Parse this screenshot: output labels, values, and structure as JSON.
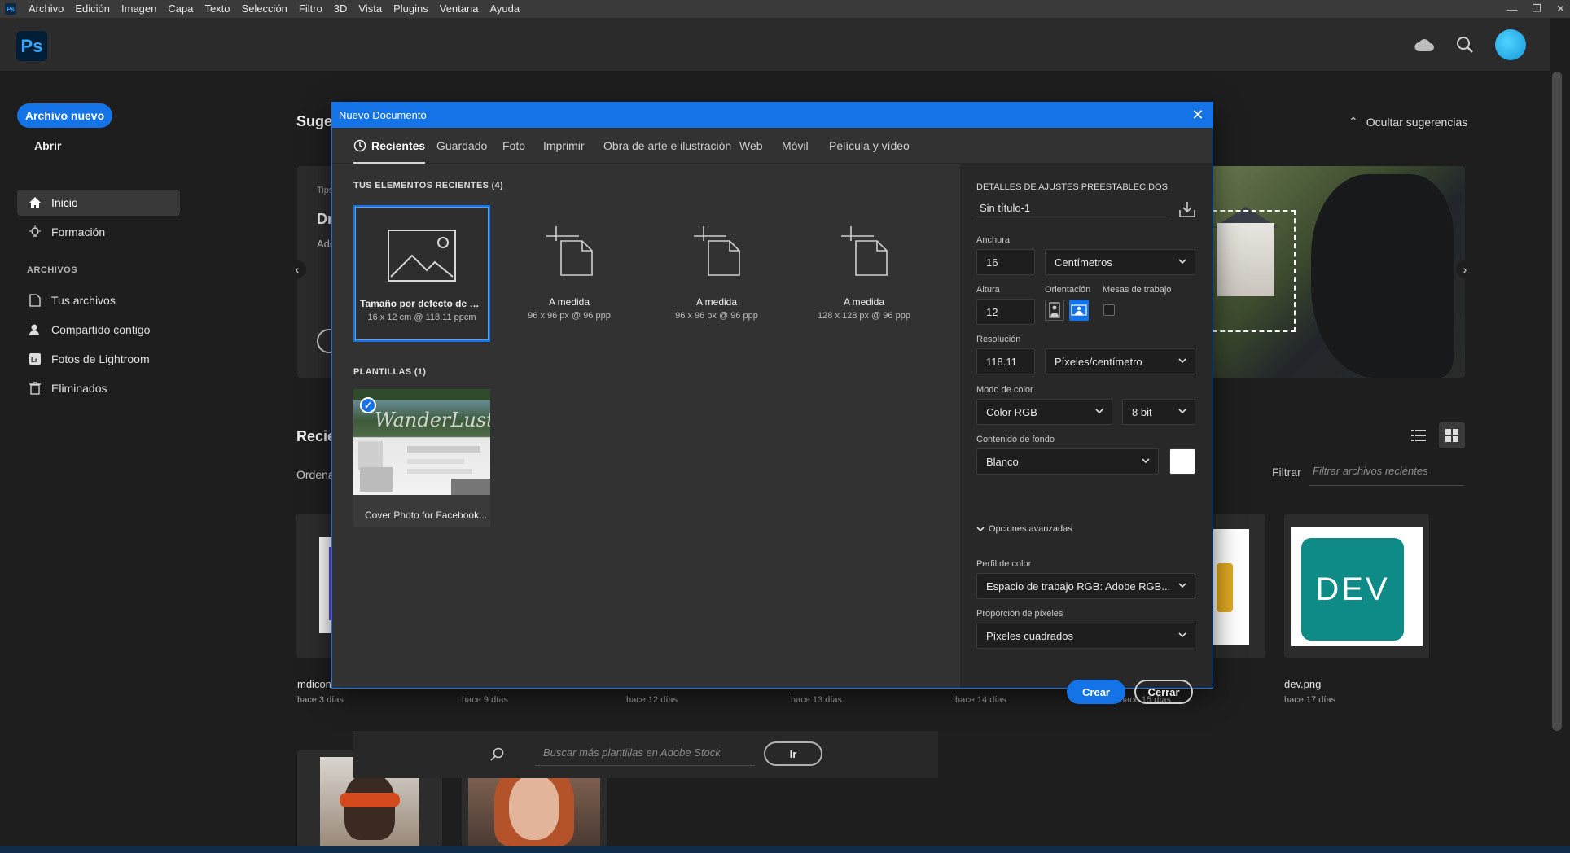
{
  "menubar": {
    "app_icon": "Ps",
    "items": [
      "Archivo",
      "Edición",
      "Imagen",
      "Capa",
      "Texto",
      "Selección",
      "Filtro",
      "3D",
      "Vista",
      "Plugins",
      "Ventana",
      "Ayuda"
    ]
  },
  "header": {
    "logo": "Ps",
    "icons": [
      "cloud-icon",
      "search-icon",
      "avatar"
    ]
  },
  "sidebar": {
    "new_file": "Archivo nuevo",
    "open": "Abrir",
    "nav": [
      {
        "label": "Inicio",
        "icon": "home-icon",
        "active": true
      },
      {
        "label": "Formación",
        "icon": "lightbulb-icon",
        "active": false
      }
    ],
    "files_section": "ARCHIVOS",
    "files": [
      {
        "label": "Tus archivos",
        "icon": "file-icon"
      },
      {
        "label": "Compartido contigo",
        "icon": "shared-user-icon"
      },
      {
        "label": "Fotos de Lightroom",
        "icon": "lightroom-icon"
      },
      {
        "label": "Eliminados",
        "icon": "trash-icon"
      }
    ]
  },
  "home": {
    "suggestions_title_partial": "Suger",
    "hide_suggestions": "Ocultar sugerencias",
    "banner_partial": {
      "tips": "Tips",
      "heading": "Dr",
      "sub": "Adc"
    },
    "recent_title_partial": "Recie",
    "sort_partial": "Ordena",
    "filter_label": "Filtrar",
    "filter_placeholder": "Filtrar archivos recientes",
    "files": [
      {
        "name": "mdicon",
        "date": "hace 3 días"
      },
      {
        "name": "",
        "date": "hace 9 días"
      },
      {
        "name": "",
        "date": "hace 12 días"
      },
      {
        "name": "",
        "date": "hace 13 días"
      },
      {
        "name": "",
        "date": "hace 14 días"
      },
      {
        "name": "",
        "date": "hace 15 días"
      },
      {
        "name": "dev.png",
        "date": "hace 17 días",
        "thumb_text": "DEV"
      }
    ]
  },
  "dialog": {
    "title": "Nuevo Documento",
    "tabs": [
      "Recientes",
      "Guardado",
      "Foto",
      "Imprimir",
      "Obra de arte e ilustración",
      "Web",
      "Móvil",
      "Película y vídeo"
    ],
    "active_tab": "Recientes",
    "recent_heading": "TUS ELEMENTOS RECIENTES",
    "recent_count": "(4)",
    "presets": [
      {
        "name": "Tamaño por defecto de Ph...",
        "dims": "16 x 12 cm @ 118.11 ppcm",
        "selected": true
      },
      {
        "name": "A medida",
        "dims": "96 x 96 px @ 96 ppp",
        "selected": false
      },
      {
        "name": "A medida",
        "dims": "96 x 96 px @ 96 ppp",
        "selected": false
      },
      {
        "name": "A medida",
        "dims": "128 x 128 px @ 96 ppp",
        "selected": false
      }
    ],
    "templates_heading": "PLANTILLAS",
    "templates_count": "(1)",
    "template": {
      "name": "Cover Photo for Facebook...",
      "overlay_text": "WanderLust"
    },
    "stock_placeholder": "Buscar más plantillas en Adobe Stock",
    "stock_button": "Ir",
    "details": {
      "heading": "DETALLES DE AJUSTES PREESTABLECIDOS",
      "preset_name": "Sin título-1",
      "width_label": "Anchura",
      "width_value": "16",
      "width_unit": "Centímetros",
      "height_label": "Altura",
      "height_value": "12",
      "orientation_label": "Orientación",
      "artboards_label": "Mesas de trabajo",
      "resolution_label": "Resolución",
      "resolution_value": "118.11",
      "resolution_unit": "Píxeles/centímetro",
      "color_mode_label": "Modo de color",
      "color_mode": "Color RGB",
      "bit_depth": "8 bit",
      "background_label": "Contenido de fondo",
      "background": "Blanco",
      "background_swatch": "#ffffff",
      "advanced": "Opciones avanzadas",
      "color_profile_label": "Perfil de color",
      "color_profile": "Espacio de trabajo RGB: Adobe RGB...",
      "pixel_aspect_label": "Proporción de píxeles",
      "pixel_aspect": "Píxeles cuadrados",
      "create_button": "Crear",
      "close_button": "Cerrar"
    }
  },
  "colors": {
    "accent": "#1473e6",
    "ps_blue": "#31a8ff",
    "bg": "#1e1e1e",
    "panel": "#323232"
  }
}
